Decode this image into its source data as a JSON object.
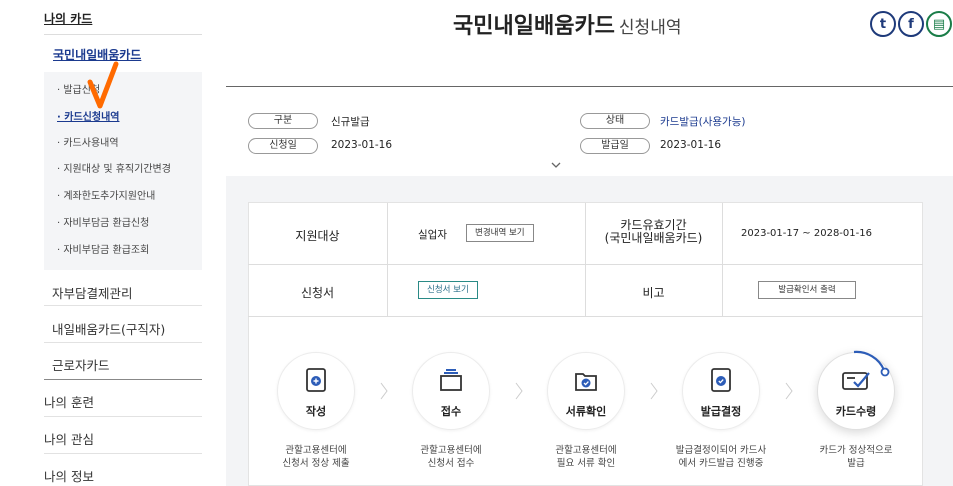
{
  "sidebar": {
    "top_title": "나의 카드",
    "sub_title": "국민내일배움카드",
    "items": [
      {
        "label": "· 발급신청"
      },
      {
        "label": "· 카드신청내역"
      },
      {
        "label": "· 카드사용내역"
      },
      {
        "label": "· 지원대상 및 휴직기간변경"
      },
      {
        "label": "· 계좌한도추가지원안내"
      },
      {
        "label": "· 자비부담금 환급신청"
      },
      {
        "label": "· 자비부담금 환급조회"
      }
    ],
    "menus": [
      "자부담결제관리",
      "내일배움카드(구직자)",
      "근로자카드"
    ],
    "main_menus": [
      "나의 훈련",
      "나의 관심",
      "나의 정보"
    ]
  },
  "header": {
    "title": "국민내일배움카드",
    "title_suffix": "신청내역",
    "share": [
      {
        "name": "twitter-icon",
        "glyph": "t"
      },
      {
        "name": "facebook-icon",
        "glyph": "f"
      },
      {
        "name": "print-icon",
        "glyph": "▤"
      }
    ]
  },
  "info": {
    "type_label": "구분",
    "type_value": "신규발급",
    "date_label": "신청일",
    "date_value": "2023-01-16",
    "status_label": "상태",
    "status_value": "카드발급(사용가능)",
    "issue_label": "발급일",
    "issue_value": "2023-01-16"
  },
  "table": {
    "support_label": "지원대상",
    "support_value": "실업자",
    "support_btn": "변경내역 보기",
    "validity_label_1": "카드유효기간",
    "validity_label_2": "(국민내일배움카드)",
    "validity_value": "2023-01-17 ~ 2028-01-16",
    "application_label": "신청서",
    "application_btn": "신청서 보기",
    "note_label": "비고",
    "note_btn": "발급확인서 출력"
  },
  "steps": [
    {
      "label": "작성",
      "desc": "관할고용센터에\n신청서 정상 제출"
    },
    {
      "label": "접수",
      "desc": "관할고용센터에\n신청서 접수"
    },
    {
      "label": "서류확인",
      "desc": "관할고용센터에\n필요 서류 확인"
    },
    {
      "label": "발급결정",
      "desc": "발급결정이되어 카드사\n에서 카드발급 진행중"
    },
    {
      "label": "카드수령",
      "desc": "카드가 정상적으로\n발급"
    }
  ],
  "colors": {
    "accent_navy": "#1b3a8f",
    "icon_blue": "#2d5db8",
    "check_orange": "#ff6a00",
    "panel_gray": "#f3f4f6"
  }
}
